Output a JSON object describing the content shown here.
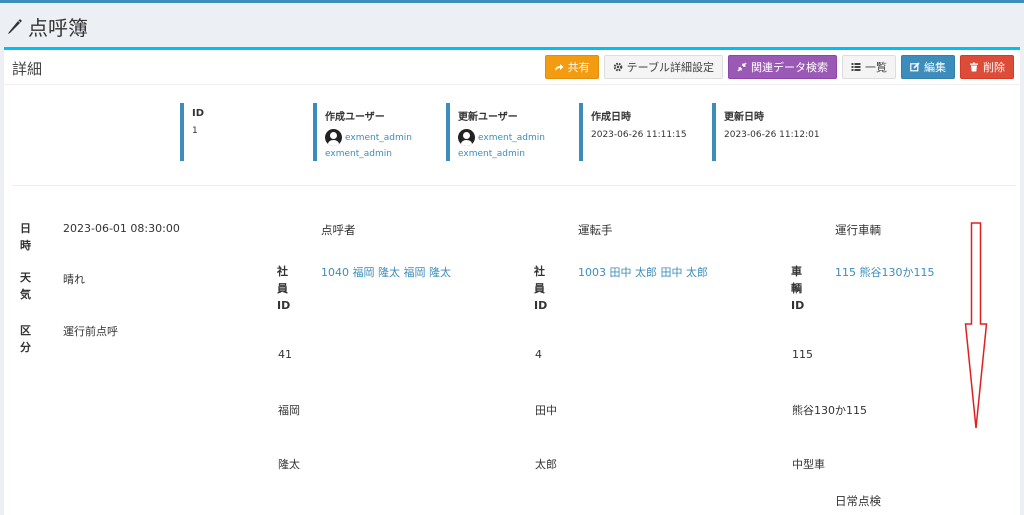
{
  "page": {
    "title": "点呼簿"
  },
  "box": {
    "title": "詳細"
  },
  "buttons": {
    "share": "共有",
    "table_settings": "テーブル詳細設定",
    "related_search": "関連データ検索",
    "list": "一覧",
    "edit": "編集",
    "delete": "削除"
  },
  "meta": {
    "id": {
      "label": "ID",
      "value": "1"
    },
    "created_user": {
      "label": "作成ユーザー",
      "name": "exment_admin",
      "name2": "exment_admin"
    },
    "updated_user": {
      "label": "更新ユーザー",
      "name": "exment_admin",
      "name2": "exment_admin"
    },
    "created_at": {
      "label": "作成日時",
      "value": "2023-06-26 11:11:15"
    },
    "updated_at": {
      "label": "更新日時",
      "value": "2023-06-26 11:12:01"
    }
  },
  "fields": {
    "datetime": {
      "label": "日時",
      "value": "2023-06-01 08:30:00"
    },
    "weather": {
      "label": "天気",
      "value": "晴れ"
    },
    "category": {
      "label": "区分",
      "value": "運行前点呼"
    }
  },
  "roll_caller": {
    "title": "点呼者",
    "employee_id_label": "社員ID",
    "link": "1040 福岡 隆太 福岡 隆太",
    "id": "41",
    "last_name": "福岡",
    "first_name": "隆太"
  },
  "driver": {
    "title": "運転手",
    "employee_id_label": "社員ID",
    "link": "1003 田中 太郎 田中 太郎",
    "id": "4",
    "last_name": "田中",
    "first_name": "太郎"
  },
  "vehicle": {
    "title": "運行車輌",
    "vehicle_id_label": "車輌ID",
    "link": "115 熊谷130か115",
    "id": "115",
    "plate": "熊谷130か115",
    "size": "中型車"
  },
  "daily_check": {
    "title": "日常点検"
  },
  "colors": {
    "primary": "#3c8dbc",
    "accent": "#00c0ef",
    "annotation": "#e02020"
  }
}
